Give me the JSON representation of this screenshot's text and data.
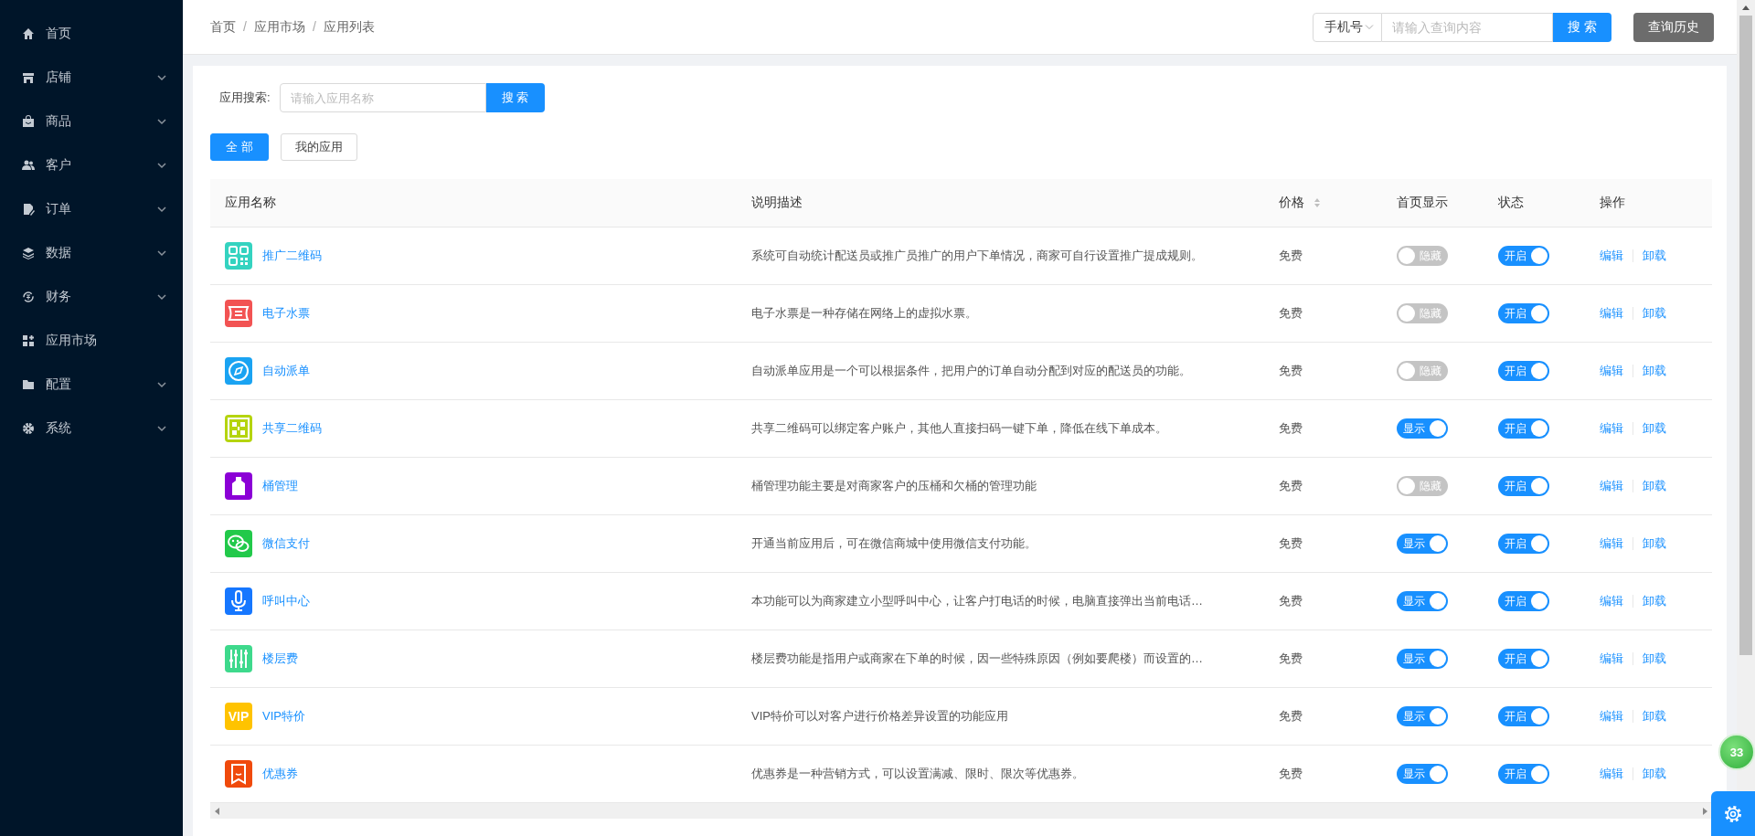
{
  "sidebar": {
    "items": [
      {
        "label": "首页",
        "has_submenu": false
      },
      {
        "label": "店铺",
        "has_submenu": true
      },
      {
        "label": "商品",
        "has_submenu": true
      },
      {
        "label": "客户",
        "has_submenu": true
      },
      {
        "label": "订单",
        "has_submenu": true
      },
      {
        "label": "数据",
        "has_submenu": true
      },
      {
        "label": "财务",
        "has_submenu": true
      },
      {
        "label": "应用市场",
        "has_submenu": false
      },
      {
        "label": "配置",
        "has_submenu": true
      },
      {
        "label": "系统",
        "has_submenu": true
      }
    ]
  },
  "header": {
    "breadcrumb": [
      "首页",
      "应用市场",
      "应用列表"
    ],
    "separator": "/",
    "query_type": "手机号",
    "query_placeholder": "请输入查询内容",
    "search_button": "搜 索",
    "history_button": "查询历史"
  },
  "filter": {
    "label": "应用搜索:",
    "placeholder": "请输入应用名称",
    "search_button": "搜 索"
  },
  "tabs": [
    {
      "label": "全 部",
      "selected": true
    },
    {
      "label": "我的应用",
      "selected": false
    }
  ],
  "table": {
    "columns": [
      {
        "label": "应用名称",
        "sortable": false
      },
      {
        "label": "说明描述",
        "sortable": false
      },
      {
        "label": "价格",
        "sortable": true
      },
      {
        "label": "首页显示",
        "sortable": false
      },
      {
        "label": "状态",
        "sortable": false
      },
      {
        "label": "操作",
        "sortable": false
      }
    ],
    "rows": [
      {
        "name": "推广二维码",
        "color": "#34d3c0",
        "description": "系统可自动统计配送员或推广员推广的用户下单情况，商家可自行设置推广提成规则。",
        "price": "免费",
        "homepage_shown": false,
        "homepage_label": "隐藏",
        "status_on": true,
        "status_label": "开启",
        "actions": [
          "编辑",
          "卸载"
        ]
      },
      {
        "name": "电子水票",
        "color": "#f25353",
        "description": "电子水票是一种存储在网络上的虚拟水票。",
        "price": "免费",
        "homepage_shown": false,
        "homepage_label": "隐藏",
        "status_on": true,
        "status_label": "开启",
        "actions": [
          "编辑",
          "卸载"
        ]
      },
      {
        "name": "自动派单",
        "color": "#1aa3f2",
        "description": "自动派单应用是一个可以根据条件，把用户的订单自动分配到对应的配送员的功能。",
        "price": "免费",
        "homepage_shown": false,
        "homepage_label": "隐藏",
        "status_on": true,
        "status_label": "开启",
        "actions": [
          "编辑",
          "卸载"
        ]
      },
      {
        "name": "共享二维码",
        "color": "#b5d40f",
        "description": "共享二维码可以绑定客户账户，其他人直接扫码一键下单，降低在线下单成本。",
        "price": "免费",
        "homepage_shown": true,
        "homepage_label": "显示",
        "status_on": true,
        "status_label": "开启",
        "actions": [
          "编辑",
          "卸载"
        ]
      },
      {
        "name": "桶管理",
        "color": "#8b00d6",
        "description": "桶管理功能主要是对商家客户的压桶和欠桶的管理功能",
        "price": "免费",
        "homepage_shown": false,
        "homepage_label": "隐藏",
        "status_on": true,
        "status_label": "开启",
        "actions": [
          "编辑",
          "卸载"
        ]
      },
      {
        "name": "微信支付",
        "color": "#22c94a",
        "description": "开通当前应用后，可在微信商城中使用微信支付功能。",
        "price": "免费",
        "homepage_shown": true,
        "homepage_label": "显示",
        "status_on": true,
        "status_label": "开启",
        "actions": [
          "编辑",
          "卸载"
        ]
      },
      {
        "name": "呼叫中心",
        "color": "#1677ff",
        "description": "本功能可以为商家建立小型呼叫中心，让客户打电话的时候，电脑直接弹出当前电话…",
        "price": "免费",
        "homepage_shown": true,
        "homepage_label": "显示",
        "status_on": true,
        "status_label": "开启",
        "actions": [
          "编辑",
          "卸载"
        ]
      },
      {
        "name": "楼层费",
        "color": "#3ed98c",
        "description": "楼层费功能是指用户或商家在下单的时候，因一些特殊原因（例如要爬楼）而设置的…",
        "price": "免费",
        "homepage_shown": true,
        "homepage_label": "显示",
        "status_on": true,
        "status_label": "开启",
        "actions": [
          "编辑",
          "卸载"
        ]
      },
      {
        "name": "VIP特价",
        "color": "#ffc300",
        "icon_label": "VIP",
        "description": "VIP特价可以对客户进行价格差异设置的功能应用",
        "price": "免费",
        "homepage_shown": true,
        "homepage_label": "显示",
        "status_on": true,
        "status_label": "开启",
        "actions": [
          "编辑",
          "卸载"
        ]
      },
      {
        "name": "优惠券",
        "color": "#f04a0c",
        "description": "优惠券是一种营销方式，可以设置满减、限时、限次等优惠券。",
        "price": "免费",
        "homepage_shown": true,
        "homepage_label": "显示",
        "status_on": true,
        "status_label": "开启",
        "actions": [
          "编辑",
          "卸载"
        ]
      }
    ]
  },
  "floating": {
    "badge": "33"
  }
}
